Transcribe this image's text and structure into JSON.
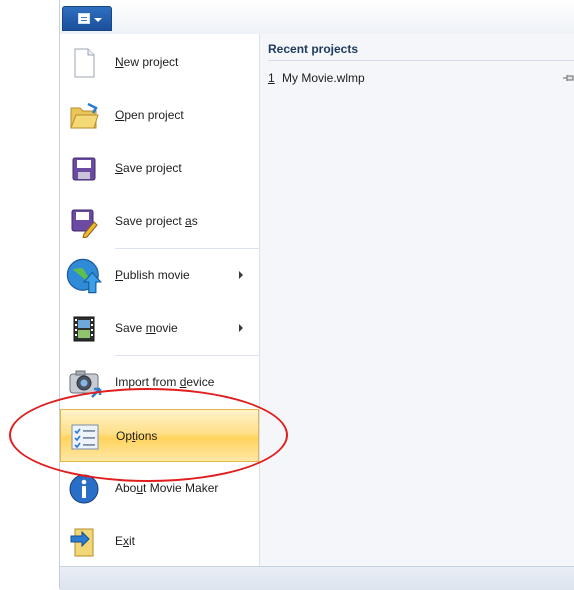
{
  "menu": {
    "items": [
      {
        "id": "new-project",
        "pre": "",
        "ul": "N",
        "post": "ew project",
        "submenu": false
      },
      {
        "id": "open-project",
        "pre": "",
        "ul": "O",
        "post": "pen project",
        "submenu": false
      },
      {
        "id": "save-project",
        "pre": "",
        "ul": "S",
        "post": "ave project",
        "submenu": false
      },
      {
        "id": "save-project-as",
        "pre": "Save project ",
        "ul": "a",
        "post": "s",
        "submenu": false
      },
      {
        "id": "publish-movie",
        "pre": "",
        "ul": "P",
        "post": "ublish movie",
        "submenu": true
      },
      {
        "id": "save-movie",
        "pre": "Save ",
        "ul": "m",
        "post": "ovie",
        "submenu": true
      },
      {
        "id": "import-from-device",
        "pre": "Import from ",
        "ul": "d",
        "post": "evice",
        "submenu": false
      },
      {
        "id": "options",
        "pre": "Op",
        "ul": "t",
        "post": "ions",
        "submenu": false,
        "highlighted": true
      },
      {
        "id": "about-movie-maker",
        "pre": "Abo",
        "ul": "u",
        "post": "t Movie Maker",
        "submenu": false
      },
      {
        "id": "exit",
        "pre": "E",
        "ul": "x",
        "post": "it",
        "submenu": false
      }
    ]
  },
  "recent": {
    "title": "Recent projects",
    "items": [
      {
        "num": "1",
        "name": "My Movie.wlmp"
      }
    ]
  },
  "colors": {
    "highlight": "#ffd35e",
    "annotation_ring": "#e11d1d",
    "app_button": "#1a4f9b"
  },
  "icons": {
    "app_menu": "app-menu-icon",
    "new_project": "blank-document-icon",
    "open_project": "open-folder-icon",
    "save_project": "floppy-disk-icon",
    "save_project_as": "floppy-pencil-icon",
    "publish_movie": "globe-upload-icon",
    "save_movie": "film-strip-icon",
    "import_from_device": "camera-icon",
    "options": "checklist-icon",
    "about": "info-icon",
    "exit": "exit-door-icon",
    "pin": "pin-icon"
  }
}
